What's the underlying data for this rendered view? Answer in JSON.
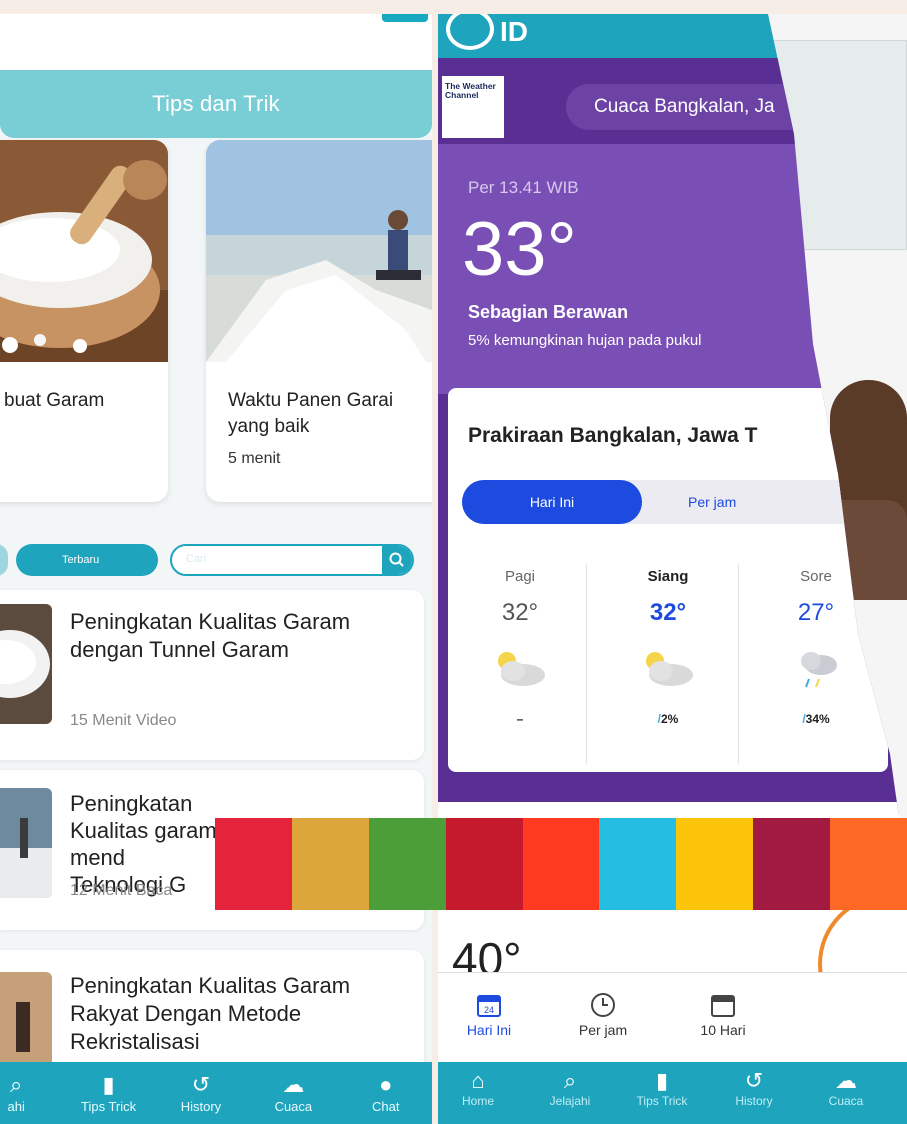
{
  "left_app": {
    "header_title": "Tips dan Trik",
    "cards": [
      {
        "title": "buat Garam",
        "subtitle": ""
      },
      {
        "title_line1": "Waktu Panen Garai",
        "title_line2": "yang baik",
        "subtitle": "5 menit"
      }
    ],
    "filters": {
      "latest_label": "Terbaru",
      "search_placeholder": "Cari"
    },
    "list": [
      {
        "title": "Peningkatan Kualitas Garam dengan Tunnel Garam",
        "meta": "15 Menit Video"
      },
      {
        "title": "Peningkatan Kualitas garam mend Teknologi G",
        "meta": "12 Menit Baca"
      },
      {
        "title": "Peningkatan Kualitas Garam Rakyat Dengan Metode Rekristalisasi",
        "meta": ""
      }
    ],
    "bottom_nav": [
      {
        "label": "ahi",
        "icon": "explore-icon"
      },
      {
        "label": "Tips Trick",
        "icon": "bookmark-icon"
      },
      {
        "label": "History",
        "icon": "history-icon"
      },
      {
        "label": "Cuaca",
        "icon": "weather-icon"
      },
      {
        "label": "Chat",
        "icon": "chat-icon"
      }
    ]
  },
  "right_app": {
    "logo_text": "ID",
    "twc_logo": "The Weather Channel",
    "location_pill": "Cuaca Bangkalan, Ja",
    "current": {
      "time": "Per 13.41 WIB",
      "temp": "33°",
      "condition": "Sebagian Berawan",
      "rain_note": "5% kemungkinan hujan pada pukul"
    },
    "forecast": {
      "title": "Prakiraan Bangkalan, Jawa T",
      "toggle_on": "Hari Ini",
      "toggle_off": "Per jam",
      "periods": [
        {
          "label": "Pagi",
          "temp": "32°",
          "rain": "–"
        },
        {
          "label": "Siang",
          "temp": "32°",
          "rain": "2%"
        },
        {
          "label": "Sore",
          "temp": "27°",
          "rain": "34%"
        }
      ]
    },
    "second_temp": "40°",
    "tabs": [
      {
        "label": "Hari Ini",
        "icon": "calendar-icon",
        "badge": "24"
      },
      {
        "label": "Per jam",
        "icon": "clock-icon"
      },
      {
        "label": "10 Hari",
        "icon": "calendar-range-icon"
      }
    ],
    "bottom_nav": [
      {
        "label": "Home",
        "icon": "home-icon"
      },
      {
        "label": "Jelajahi",
        "icon": "search-icon"
      },
      {
        "label": "Tips Trick",
        "icon": "bookmark-icon"
      },
      {
        "label": "History",
        "icon": "history-icon"
      },
      {
        "label": "Cuaca",
        "icon": "weather-icon"
      }
    ]
  },
  "strip_colors": [
    "#e5243b",
    "#dda63a",
    "#4c9f38",
    "#c5192d",
    "#ff3a21",
    "#26bde2",
    "#fcc30b",
    "#a21942",
    "#fd6925"
  ]
}
